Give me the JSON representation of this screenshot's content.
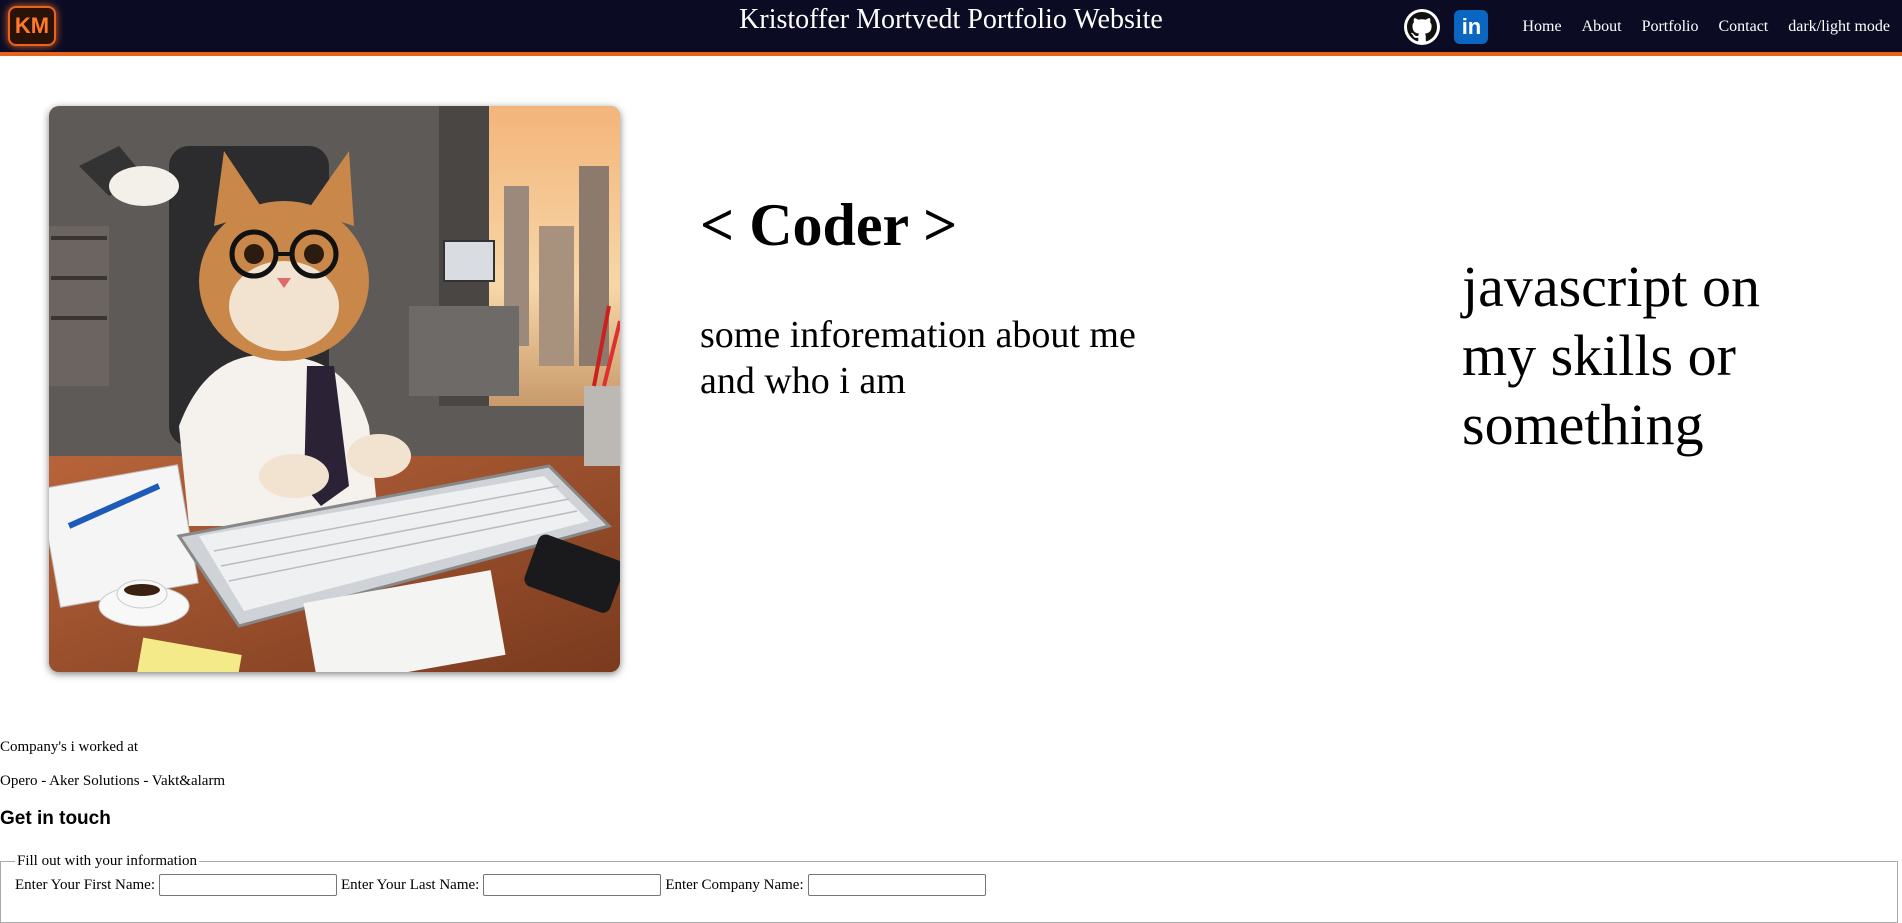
{
  "header": {
    "logo_text": "KM",
    "title": "Kristoffer Mortvedt Portfolio Website",
    "accent_color": "#e8631c",
    "background_color": "#0b0c24",
    "social": [
      {
        "name": "github-icon"
      },
      {
        "name": "linkedin-icon",
        "label": "in"
      }
    ],
    "nav": [
      "Home",
      "About",
      "Portfolio",
      "Contact",
      "dark/light mode"
    ]
  },
  "hero": {
    "heading": "< Coder >",
    "info": "some inforemation about me and who i am",
    "skills": "javascript on my skills or something"
  },
  "companies": {
    "title": "Company's i worked at",
    "list": "Opero - Aker Solutions - Vakt&alarm"
  },
  "contact": {
    "heading": "Get in touch",
    "legend": "Fill out with your information",
    "fields": [
      {
        "label": "Enter Your First Name:",
        "value": ""
      },
      {
        "label": "Enter Your Last Name:",
        "value": ""
      },
      {
        "label": "Enter Company Name:",
        "value": ""
      }
    ]
  }
}
